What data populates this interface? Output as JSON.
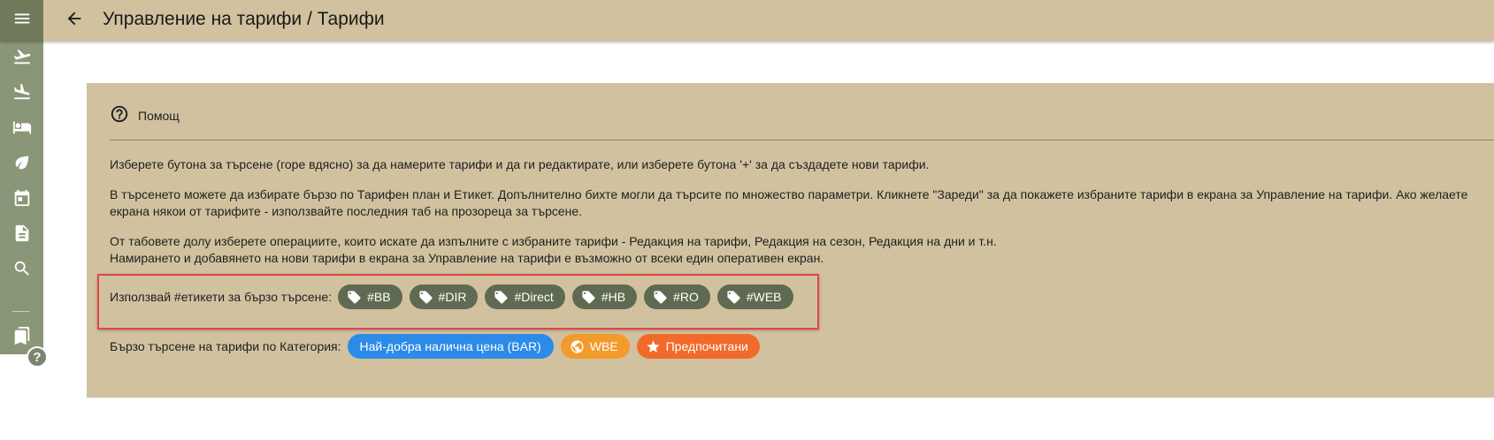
{
  "header": {
    "title": "Управление на тарифи / Тарифи",
    "menu_icon": "menu-icon",
    "back_icon": "arrow-left-icon"
  },
  "sidebar": {
    "items": [
      {
        "icon": "flight-takeoff-icon"
      },
      {
        "icon": "flight-land-icon"
      },
      {
        "icon": "bed-icon"
      },
      {
        "icon": "leaf-icon"
      },
      {
        "icon": "calendar-icon"
      },
      {
        "icon": "document-icon"
      },
      {
        "icon": "search-icon"
      },
      {
        "icon": "bookmarks-icon"
      }
    ],
    "help_badge": "?"
  },
  "help": {
    "label": "Помощ",
    "icon": "help-circle-icon",
    "paragraphs": [
      "Изберете бутона за търсене (горе вдясно) за да намерите тарифи и да ги редактирате, или изберете бутона '+' за да създадете нови тарифи.",
      "В търсенето можете да избирате бързо по Тарифен план и Етикет. Допълнително бихте могли да търсите по множество параметри. Кликнете \"Зареди\" за да покажете избраните тарифи в екрана за Управление на тарифи. Ако желаете",
      "екрана някои от тарифите - използвайте последния таб на прозореца за търсене.",
      "От табовете долу изберете операциите, които искате да изпълните с избраните тарифи - Редакция на тарифи, Редакция на сезон, Редакция на дни и т.н.",
      "Намирането и добавянето на нови тарифи в екрана за Управление на тарифи е възможно от всеки един оперативен екран."
    ]
  },
  "tags": {
    "label": "Използвай #етикети за бързо търсене:",
    "items": [
      "#BB",
      "#DIR",
      "#Direct",
      "#HB",
      "#RO",
      "#WEB"
    ]
  },
  "categories": {
    "label": "Бързо търсене на тарифи по Категория:",
    "items": [
      {
        "label": "Най-добра налична цена (BAR)",
        "color": "#2c8be8"
      },
      {
        "label": "WBE",
        "color": "#f39a2d",
        "icon": "globe-icon"
      },
      {
        "label": "Предпочитани",
        "color": "#f26a2a",
        "icon": "star-icon"
      }
    ]
  },
  "colors": {
    "header_bg": "#d1c19f",
    "sidebar_bg": "#8a9678",
    "tag_chip_bg": "#5f6a52",
    "highlight_border": "#e0464a"
  }
}
